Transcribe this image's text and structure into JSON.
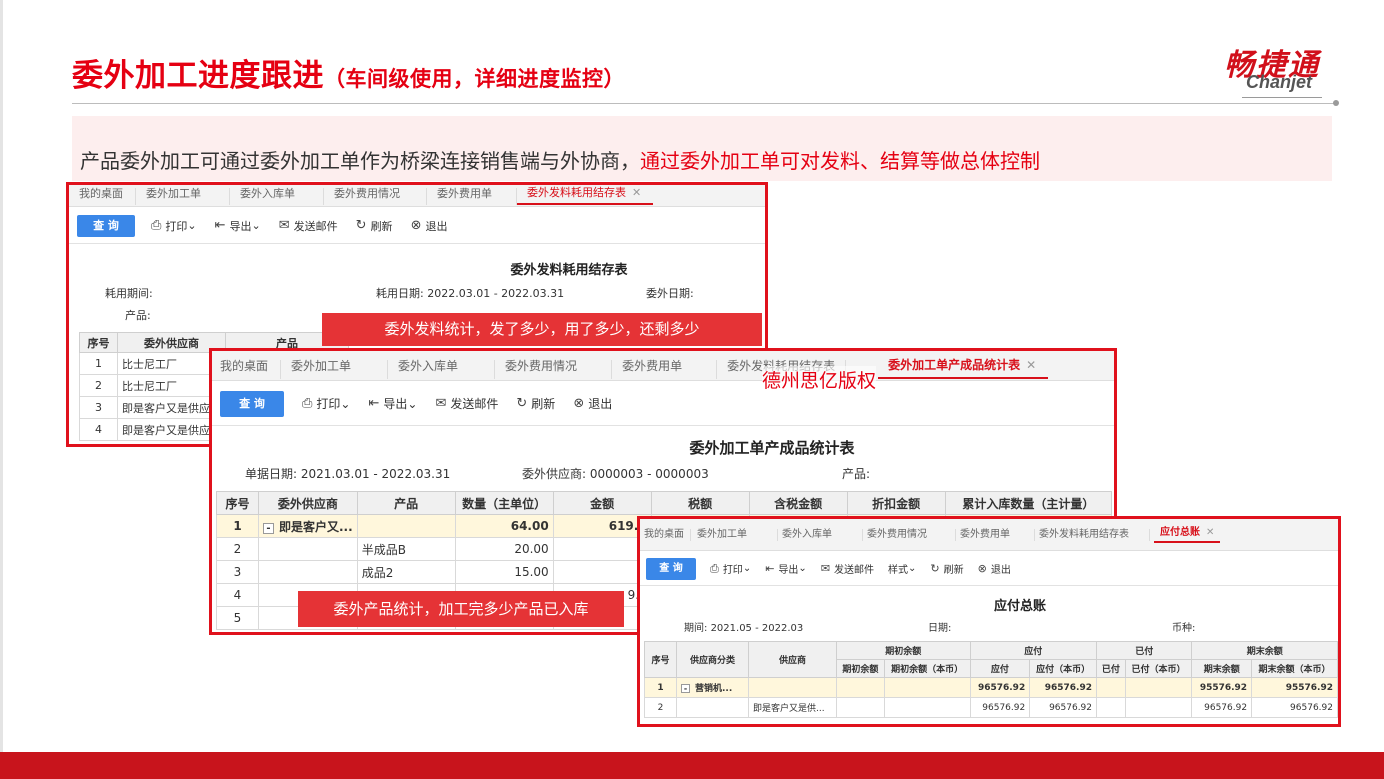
{
  "slide": {
    "title": "委外加工进度跟进",
    "subtitle": "（车间级使用，详细进度监控）",
    "description_plain": "产品委外加工可通过委外加工单作为桥梁连接销售端与外协商，",
    "description_red": "通过委外加工单可对发料、结算等做总体控制",
    "logo_cn": "畅捷通",
    "logo_en": "Chanjet",
    "watermark": "德州思亿版权",
    "accent_color": "#e50012"
  },
  "window1": {
    "tabs": [
      "我的桌面",
      "委外加工单",
      "委外入库单",
      "委外费用情况",
      "委外费用单",
      "委外发料耗用结存表"
    ],
    "active_close": "✕",
    "toolbar": {
      "query": "查 询",
      "print": "打印",
      "export": "导出",
      "send": "发送邮件",
      "refresh": "刷新",
      "exit": "退出"
    },
    "report_title": "委外发料耗用结存表",
    "meta": {
      "period_label": "耗用期间:",
      "date_label": "耗用日期:",
      "date_value": "2022.03.01 - 2022.03.31",
      "out_date_label": "委外日期:",
      "product_label": "产品:"
    },
    "headers": [
      "序号",
      "委外供应商",
      "产品"
    ],
    "rows": [
      {
        "no": "1",
        "supplier": "比士尼工厂"
      },
      {
        "no": "2",
        "supplier": "比士尼工厂"
      },
      {
        "no": "3",
        "supplier": "即是客户又是供应商"
      },
      {
        "no": "4",
        "supplier": "即是客户又是供应商"
      }
    ],
    "callout": "委外发料统计，发了多少，用了多少，还剩多少"
  },
  "window2": {
    "tabs": [
      "我的桌面",
      "委外加工单",
      "委外入库单",
      "委外费用情况",
      "委外费用单",
      "委外发料耗用结存表",
      "委外加工单产成品统计表"
    ],
    "active_close": "✕",
    "toolbar": {
      "query": "查 询",
      "print": "打印",
      "export": "导出",
      "send": "发送邮件",
      "refresh": "刷新",
      "exit": "退出"
    },
    "report_title": "委外加工单产成品统计表",
    "meta": {
      "bill_date_label": "单据日期:",
      "bill_date_value": "2021.03.01 - 2022.03.31",
      "supplier_label": "委外供应商:",
      "supplier_value": "0000003 - 0000003",
      "product_label": "产品:"
    },
    "headers": [
      "序号",
      "委外供应商",
      "产品",
      "数量（主单位）",
      "金额",
      "税额",
      "含税金额",
      "折扣金额",
      "累计入库数量（主计量）"
    ],
    "rows": [
      {
        "no": "1",
        "supplier": "即是客户又...",
        "product": "",
        "qty": "64.00",
        "amount": "619.0"
      },
      {
        "no": "2",
        "supplier": "",
        "product": "半成品B",
        "qty": "20.00",
        "amount": ""
      },
      {
        "no": "3",
        "supplier": "",
        "product": "成品2",
        "qty": "15.00",
        "amount": ""
      },
      {
        "no": "4",
        "supplier": "",
        "product": "",
        "qty": "",
        "amount": "9.0"
      },
      {
        "no": "5",
        "supplier": "",
        "product": "",
        "qty": "",
        "amount": ""
      }
    ],
    "callout": "委外产品统计，加工完多少产品已入库"
  },
  "window3": {
    "tabs": [
      "我的桌面",
      "委外加工单",
      "委外入库单",
      "委外费用情况",
      "委外费用单",
      "委外发料耗用结存表",
      "应付总账"
    ],
    "active_close": "✕",
    "toolbar": {
      "query": "查 询",
      "print": "打印",
      "export": "导出",
      "send": "发送邮件",
      "style": "样式",
      "refresh": "刷新",
      "exit": "退出"
    },
    "report_title": "应付总账",
    "meta": {
      "period_label": "期间:",
      "period_value": "2021.05 - 2022.03",
      "date_label": "日期:",
      "currency_label": "币种:"
    },
    "group_headers": [
      "期初余额",
      "应付",
      "已付",
      "期末余额"
    ],
    "headers": {
      "no": "序号",
      "category": "供应商分类",
      "supplier": "供应商",
      "sub": [
        "期初余额",
        "期初余额（本币）",
        "应付",
        "应付（本币）",
        "已付",
        "已付（本币）",
        "期末余额",
        "期末余额（本币）"
      ]
    },
    "rows": [
      {
        "no": "1",
        "category": "营销机...",
        "supplier": "",
        "payable": "96576.92",
        "payable_local": "96576.92",
        "end": "95576.92",
        "end_local": "95576.92"
      },
      {
        "no": "2",
        "category": "",
        "supplier": "即是客户又是供...",
        "payable": "96576.92",
        "payable_local": "96576.92",
        "end": "96576.92",
        "end_local": "96576.92"
      }
    ]
  }
}
